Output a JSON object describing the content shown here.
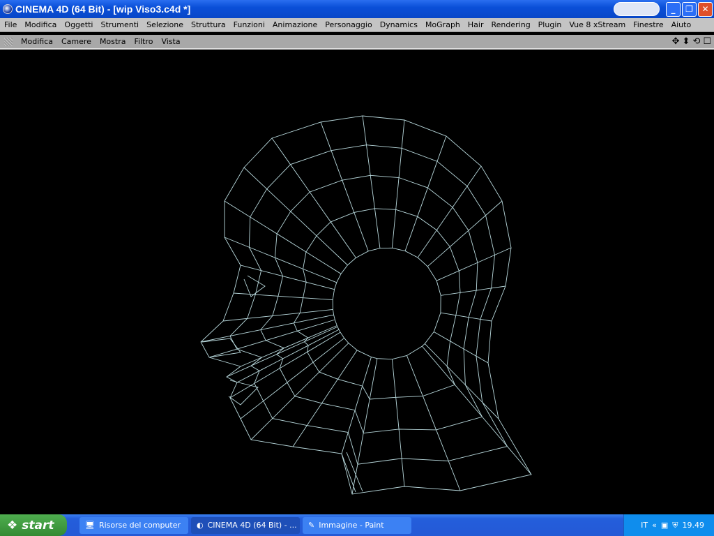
{
  "window": {
    "title": "CINEMA 4D (64 Bit) - [wip Viso3.c4d *]"
  },
  "menubar": [
    "File",
    "Modifica",
    "Oggetti",
    "Strumenti",
    "Selezione",
    "Struttura",
    "Funzioni",
    "Animazione",
    "Personaggio",
    "Dynamics",
    "MoGraph",
    "Hair",
    "Rendering",
    "Plugin",
    "Vue 8 xStream",
    "Finestre",
    "Aiuto"
  ],
  "viewport_menu": [
    "Modifica",
    "Camere",
    "Mostra",
    "Filtro",
    "Vista"
  ],
  "viewport": {
    "background": "#000000",
    "wire_color": "#b8d8dc"
  },
  "taskbar": {
    "start": "start",
    "items": [
      {
        "label": "Risorse del computer",
        "active": false
      },
      {
        "label": "CINEMA 4D (64 Bit) - ...",
        "active": true
      },
      {
        "label": "Immagine - Paint",
        "active": false
      }
    ],
    "lang": "IT",
    "clock": "19.49"
  }
}
